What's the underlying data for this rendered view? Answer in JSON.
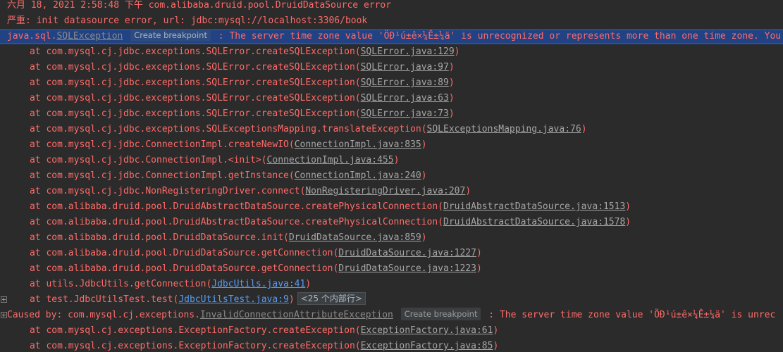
{
  "console": {
    "lines": [
      {
        "text": "六月 18, 2021 2:58:48 下午 com.alibaba.druid.pool.DruidDataSource error"
      },
      {
        "text": "严重: init datasource error, url: jdbc:mysql://localhost:3306/book"
      },
      {
        "pre": "java.sql.",
        "link": "SQLException",
        "badge": "Create breakpoint",
        "post": " : The server time zone value 'ÖÐ¹ú±ê×¼Ê±¼ä' is unrecognized or represents more than one time zone. You"
      },
      {
        "pre": "at com.mysql.cj.jdbc.exceptions.SQLError.createSQLException(",
        "link": "SQLError.java:129",
        "post": ")"
      },
      {
        "pre": "at com.mysql.cj.jdbc.exceptions.SQLError.createSQLException(",
        "link": "SQLError.java:97",
        "post": ")"
      },
      {
        "pre": "at com.mysql.cj.jdbc.exceptions.SQLError.createSQLException(",
        "link": "SQLError.java:89",
        "post": ")"
      },
      {
        "pre": "at com.mysql.cj.jdbc.exceptions.SQLError.createSQLException(",
        "link": "SQLError.java:63",
        "post": ")"
      },
      {
        "pre": "at com.mysql.cj.jdbc.exceptions.SQLError.createSQLException(",
        "link": "SQLError.java:73",
        "post": ")"
      },
      {
        "pre": "at com.mysql.cj.jdbc.exceptions.SQLExceptionsMapping.translateException(",
        "link": "SQLExceptionsMapping.java:76",
        "post": ")"
      },
      {
        "pre": "at com.mysql.cj.jdbc.ConnectionImpl.createNewIO(",
        "link": "ConnectionImpl.java:835",
        "post": ")"
      },
      {
        "pre": "at com.mysql.cj.jdbc.ConnectionImpl.<init>(",
        "link": "ConnectionImpl.java:455",
        "post": ")"
      },
      {
        "pre": "at com.mysql.cj.jdbc.ConnectionImpl.getInstance(",
        "link": "ConnectionImpl.java:240",
        "post": ")"
      },
      {
        "pre": "at com.mysql.cj.jdbc.NonRegisteringDriver.connect(",
        "link": "NonRegisteringDriver.java:207",
        "post": ")"
      },
      {
        "pre": "at com.alibaba.druid.pool.DruidAbstractDataSource.createPhysicalConnection(",
        "link": "DruidAbstractDataSource.java:1513",
        "post": ")"
      },
      {
        "pre": "at com.alibaba.druid.pool.DruidAbstractDataSource.createPhysicalConnection(",
        "link": "DruidAbstractDataSource.java:1578",
        "post": ")"
      },
      {
        "pre": "at com.alibaba.druid.pool.DruidDataSource.init(",
        "link": "DruidDataSource.java:859",
        "post": ")"
      },
      {
        "pre": "at com.alibaba.druid.pool.DruidDataSource.getConnection(",
        "link": "DruidDataSource.java:1227",
        "post": ")"
      },
      {
        "pre": "at com.alibaba.druid.pool.DruidDataSource.getConnection(",
        "link": "DruidDataSource.java:1223",
        "post": ")"
      },
      {
        "pre": "at utils.JdbcUtils.getConnection(",
        "link": "JdbcUtils.java:41",
        "post": ")"
      },
      {
        "pre": "at test.JdbcUtilsTest.test(",
        "link": "JdbcUtilsTest.java:9",
        "post": ")",
        "folded": "<25 个内部行>"
      },
      {
        "pre": "Caused by: com.mysql.cj.exceptions.",
        "link": "InvalidConnectionAttributeException",
        "badge": "Create breakpoint",
        "post": " : The server time zone value 'ÖÐ¹ú±ê×¼Ê±¼ä' is unrec"
      },
      {
        "pre": "at com.mysql.cj.exceptions.ExceptionFactory.createException(",
        "link": "ExceptionFactory.java:61",
        "post": ")"
      },
      {
        "pre": "at com.mysql.cj.exceptions.ExceptionFactory.createException(",
        "link": "ExceptionFactory.java:85",
        "post": ")"
      }
    ]
  }
}
